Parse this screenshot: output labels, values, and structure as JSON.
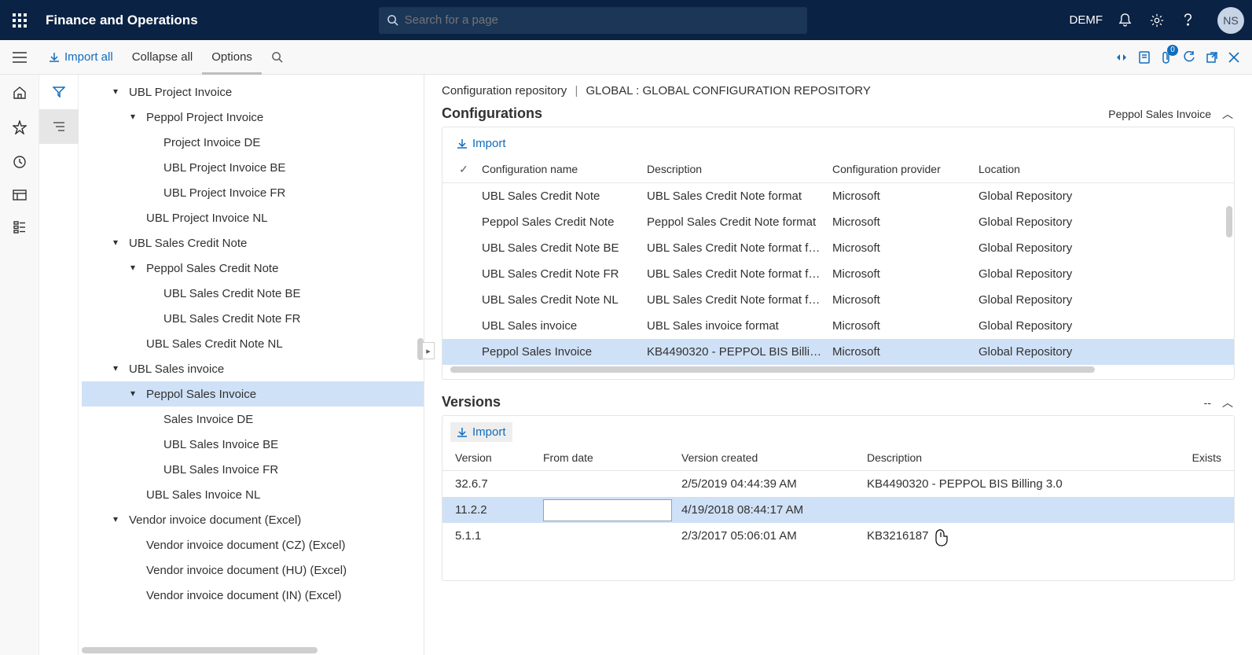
{
  "topbar": {
    "title": "Finance and Operations",
    "search_placeholder": "Search for a page",
    "company": "DEMF",
    "avatar_initials": "NS"
  },
  "actionbar": {
    "import_all": "Import all",
    "collapse_all": "Collapse all",
    "options": "Options",
    "attachment_count": "0"
  },
  "breadcrumb": {
    "a": "Configuration repository",
    "b": "GLOBAL : GLOBAL CONFIGURATION REPOSITORY"
  },
  "tree": [
    {
      "level": 1,
      "label": "UBL Project Invoice",
      "expanded": true
    },
    {
      "level": 2,
      "label": "Peppol Project Invoice",
      "expanded": true
    },
    {
      "level": 3,
      "label": "Project Invoice DE",
      "leaf": true
    },
    {
      "level": 3,
      "label": "UBL Project Invoice BE",
      "leaf": true
    },
    {
      "level": 3,
      "label": "UBL Project Invoice FR",
      "leaf": true
    },
    {
      "level": 2,
      "label": "UBL Project Invoice NL",
      "leaf": true
    },
    {
      "level": 1,
      "label": "UBL Sales Credit Note",
      "expanded": true
    },
    {
      "level": 2,
      "label": "Peppol Sales Credit Note",
      "expanded": true
    },
    {
      "level": 3,
      "label": "UBL Sales Credit Note BE",
      "leaf": true
    },
    {
      "level": 3,
      "label": "UBL Sales Credit Note FR",
      "leaf": true
    },
    {
      "level": 2,
      "label": "UBL Sales Credit Note NL",
      "leaf": true
    },
    {
      "level": 1,
      "label": "UBL Sales invoice",
      "expanded": true
    },
    {
      "level": 2,
      "label": "Peppol Sales Invoice",
      "expanded": true,
      "selected": true
    },
    {
      "level": 3,
      "label": "Sales Invoice DE",
      "leaf": true
    },
    {
      "level": 3,
      "label": "UBL Sales Invoice BE",
      "leaf": true
    },
    {
      "level": 3,
      "label": "UBL Sales Invoice FR",
      "leaf": true
    },
    {
      "level": 2,
      "label": "UBL Sales Invoice NL",
      "leaf": true
    },
    {
      "level": 1,
      "label": "Vendor invoice document (Excel)",
      "expanded": true
    },
    {
      "level": 2,
      "label": "Vendor invoice document (CZ) (Excel)",
      "leaf": true
    },
    {
      "level": 2,
      "label": "Vendor invoice document (HU) (Excel)",
      "leaf": true
    },
    {
      "level": 2,
      "label": "Vendor invoice document (IN) (Excel)",
      "leaf": true
    }
  ],
  "configurations": {
    "title": "Configurations",
    "context": "Peppol Sales Invoice",
    "import": "Import",
    "columns": {
      "name": "Configuration name",
      "desc": "Description",
      "provider": "Configuration provider",
      "location": "Location"
    },
    "rows": [
      {
        "name": "UBL Sales Credit Note",
        "desc": "UBL Sales Credit Note format",
        "provider": "Microsoft",
        "location": "Global Repository"
      },
      {
        "name": "Peppol Sales Credit Note",
        "desc": "Peppol Sales Credit Note format",
        "provider": "Microsoft",
        "location": "Global Repository"
      },
      {
        "name": "UBL Sales Credit Note BE",
        "desc": "UBL Sales Credit Note format fo...",
        "provider": "Microsoft",
        "location": "Global Repository"
      },
      {
        "name": "UBL Sales Credit Note FR",
        "desc": "UBL Sales Credit Note format fo...",
        "provider": "Microsoft",
        "location": "Global Repository"
      },
      {
        "name": "UBL Sales Credit Note NL",
        "desc": "UBL Sales Credit Note format fo...",
        "provider": "Microsoft",
        "location": "Global Repository"
      },
      {
        "name": "UBL Sales invoice",
        "desc": "UBL Sales invoice format",
        "provider": "Microsoft",
        "location": "Global Repository"
      },
      {
        "name": "Peppol Sales Invoice",
        "desc": "KB4490320 - PEPPOL BIS Billing ...",
        "provider": "Microsoft",
        "location": "Global Repository",
        "selected": true
      }
    ]
  },
  "versions": {
    "title": "Versions",
    "import": "Import",
    "dash": "--",
    "columns": {
      "ver": "Version",
      "from": "From date",
      "created": "Version created",
      "desc": "Description",
      "exists": "Exists"
    },
    "rows": [
      {
        "ver": "32.6.7",
        "from": "",
        "created": "2/5/2019 04:44:39 AM",
        "desc": "KB4490320 - PEPPOL BIS Billing 3.0",
        "exists": ""
      },
      {
        "ver": "11.2.2",
        "from": "",
        "created": "4/19/2018 08:44:17 AM",
        "desc": "",
        "exists": "",
        "selected": true,
        "editing": true
      },
      {
        "ver": "5.1.1",
        "from": "",
        "created": "2/3/2017 05:06:01 AM",
        "desc": "KB3216187",
        "exists": ""
      }
    ]
  }
}
